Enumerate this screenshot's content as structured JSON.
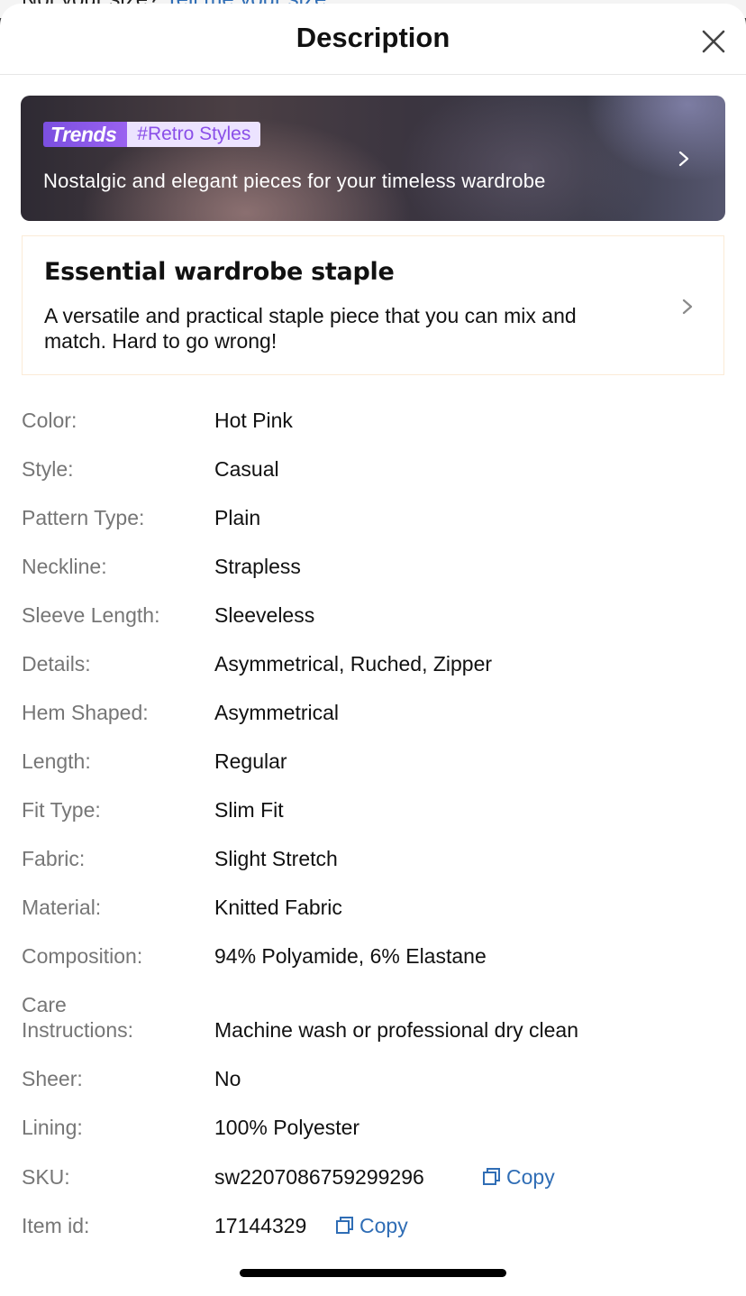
{
  "backdrop": {
    "text": "Not your size?",
    "link": "Tell me your size"
  },
  "header": {
    "title": "Description",
    "close_icon": "close-icon"
  },
  "trends": {
    "logo": "Trends",
    "tag": "#Retro Styles",
    "description": "Nostalgic and elegant pieces for your timeless wardrobe",
    "chevron_icon": "chevron-right-icon"
  },
  "staple": {
    "title": "Essential wardrobe staple",
    "description": "A versatile and practical staple piece that you can mix and match. Hard to go wrong!",
    "chevron_icon": "chevron-right-icon"
  },
  "attributes": [
    {
      "label": "Color:",
      "value": "Hot Pink"
    },
    {
      "label": "Style:",
      "value": "Casual"
    },
    {
      "label": "Pattern Type:",
      "value": "Plain"
    },
    {
      "label": "Neckline:",
      "value": "Strapless"
    },
    {
      "label": "Sleeve Length:",
      "value": "Sleeveless"
    },
    {
      "label": "Details:",
      "value": "Asymmetrical, Ruched, Zipper"
    },
    {
      "label": "Hem Shaped:",
      "value": "Asymmetrical"
    },
    {
      "label": "Length:",
      "value": "Regular"
    },
    {
      "label": "Fit Type:",
      "value": "Slim Fit"
    },
    {
      "label": "Fabric:",
      "value": "Slight Stretch"
    },
    {
      "label": "Material:",
      "value": "Knitted Fabric"
    },
    {
      "label": "Composition:",
      "value": "94% Polyamide, 6% Elastane"
    },
    {
      "label": "Care Instructions:",
      "value": "Machine wash or professional dry clean"
    },
    {
      "label": "Sheer:",
      "value": "No"
    },
    {
      "label": "Lining:",
      "value": "100% Polyester"
    }
  ],
  "sku": {
    "label": "SKU:",
    "value": "sw2207086759299296",
    "copy_label": "Copy"
  },
  "item_id": {
    "label": "Item id:",
    "value": "17144329",
    "copy_label": "Copy"
  },
  "colors": {
    "accent_link": "#2f6db5",
    "trends_purple": "#8a4fe8",
    "label_gray": "#767676"
  }
}
